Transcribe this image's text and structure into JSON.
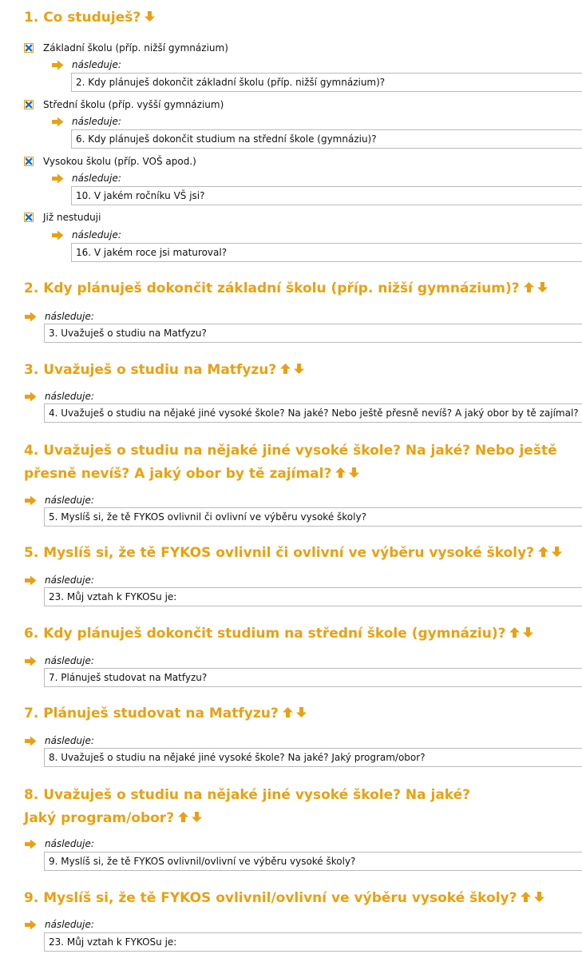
{
  "colors": {
    "accent": "#e8a112",
    "check": "#1a6fc4",
    "box_border": "#bbbbbb"
  },
  "icons": {
    "up": "arrow-up-icon",
    "down": "arrow-down-icon",
    "next": "arrow-right-icon",
    "checkbox": "checkbox-checked-icon"
  },
  "next_label": "následuje:",
  "q1": {
    "title": "1. Co studuješ?",
    "options": [
      {
        "label": "Základní školu (příp. nižší gymnázium)",
        "checked": true,
        "next": "2. Kdy plánuješ dokončit základní školu (příp. nižší gymnázium)?"
      },
      {
        "label": "Střední školu (příp. vyšší gymnázium)",
        "checked": true,
        "next": "6. Kdy plánuješ dokončit studium na střední škole (gymnáziu)?"
      },
      {
        "label": "Vysokou školu (příp. VOŠ apod.)",
        "checked": true,
        "next": "10. V jakém ročníku VŠ jsi?"
      },
      {
        "label": "Již nestuduji",
        "checked": true,
        "next": "16. V jakém roce jsi maturoval?"
      }
    ]
  },
  "questions": [
    {
      "title": "2. Kdy plánuješ dokončit základní školu (příp. nižší gymnázium)?",
      "next": "3. Uvažuješ o studiu na Matfyzu?"
    },
    {
      "title": "3. Uvažuješ o studiu na Matfyzu?",
      "next": "4. Uvažuješ o studiu na nějaké jiné vysoké škole? Na jaké? Nebo ještě přesně nevíš? A jaký obor by tě zajímal?"
    },
    {
      "title": "4. Uvažuješ o studiu na nějaké jiné vysoké škole? Na jaké? Nebo ještě přesně nevíš? A jaký obor by tě zajímal?",
      "next": "5. Myslíš si, že tě FYKOS ovlivnil či ovlivní ve výběru vysoké školy?"
    },
    {
      "title": "5. Myslíš si, že tě FYKOS ovlivnil či ovlivní ve výběru vysoké školy?",
      "next": "23. Můj vztah k FYKOSu je:"
    },
    {
      "title": "6. Kdy plánuješ dokončit studium na střední škole (gymnáziu)?",
      "next": "7. Plánuješ studovat na Matfyzu?"
    },
    {
      "title": "7. Plánuješ studovat na Matfyzu?",
      "next": "8. Uvažuješ o studiu na nějaké jiné vysoké škole? Na jaké? Jaký program/obor?"
    },
    {
      "title": "8. Uvažuješ o studiu na nějaké jiné vysoké škole? Na jaké? Jaký program/obor?",
      "next": "9. Myslíš si, že tě FYKOS ovlivnil/ovlivní ve výběru vysoké školy?"
    },
    {
      "title": "9. Myslíš si, že tě FYKOS ovlivnil/ovlivní ve výběru vysoké školy?",
      "next": "23. Můj vztah k FYKOSu je:"
    }
  ]
}
